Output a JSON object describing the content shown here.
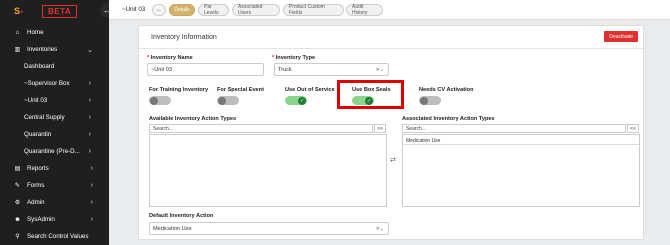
{
  "app": {
    "beta_label": "BETA"
  },
  "sidebar": {
    "items": [
      {
        "label": "Home",
        "icon": "home-icon",
        "glyph": "⌂",
        "chevron": ""
      },
      {
        "label": "Inventories",
        "icon": "chart-icon",
        "glyph": "▥",
        "chevron": "⌄"
      },
      {
        "label": "Dashboard",
        "chevron": ""
      },
      {
        "label": "~Supervisor Box",
        "chevron": "›"
      },
      {
        "label": "~Unit 03",
        "chevron": "›"
      },
      {
        "label": "Central Supply",
        "chevron": "›"
      },
      {
        "label": "Quarantin",
        "chevron": "›"
      },
      {
        "label": "Quarantine (Pre-D...",
        "chevron": "›"
      },
      {
        "label": "Reports",
        "icon": "clipboard-icon",
        "glyph": "▤",
        "chevron": "›"
      },
      {
        "label": "Forms",
        "icon": "edit-icon",
        "glyph": "✎",
        "chevron": "›"
      },
      {
        "label": "Admin",
        "icon": "gear-icon",
        "glyph": "⚙",
        "chevron": "›"
      },
      {
        "label": "SysAdmin",
        "icon": "users-icon",
        "glyph": "☻",
        "chevron": "›"
      },
      {
        "label": "Search Control Values",
        "icon": "search-icon",
        "glyph": "⚲",
        "chevron": ""
      }
    ]
  },
  "topbar": {
    "title": "~Unit 03",
    "back_glyph": "←",
    "tabs": [
      "Details",
      "Par Levels",
      "Associated Users",
      "Product Custom Fields",
      "Audit History"
    ]
  },
  "card": {
    "title": "Inventory Information",
    "deactivate_label": "Deactivate",
    "inventory_name_label": "Inventory Name",
    "inventory_name_value": "~Unit 03",
    "inventory_type_label": "Inventory Type",
    "inventory_type_value": "Truck",
    "toggles": [
      {
        "label": "For Training Inventory",
        "on": false
      },
      {
        "label": "For Special Event",
        "on": false
      },
      {
        "label": "Use Out of Service",
        "on": true
      },
      {
        "label": "Use Box Seals",
        "on": true
      },
      {
        "label": "Needs CV Activation",
        "on": false
      }
    ],
    "available_label": "Available Inventory Action Types",
    "associated_label": "Associated Inventory Action Types",
    "search_placeholder": "Search...",
    "move_right": ">>",
    "move_left": "<<",
    "associated_items": [
      "Medication Use"
    ],
    "default_action_label": "Default Inventory Action",
    "default_action_value": "Medication Use"
  },
  "colors": {
    "accent": "#d3b26b",
    "danger": "#e03131",
    "sidebar": "#1f1f1f",
    "toggle_on": "#1e7e34"
  }
}
